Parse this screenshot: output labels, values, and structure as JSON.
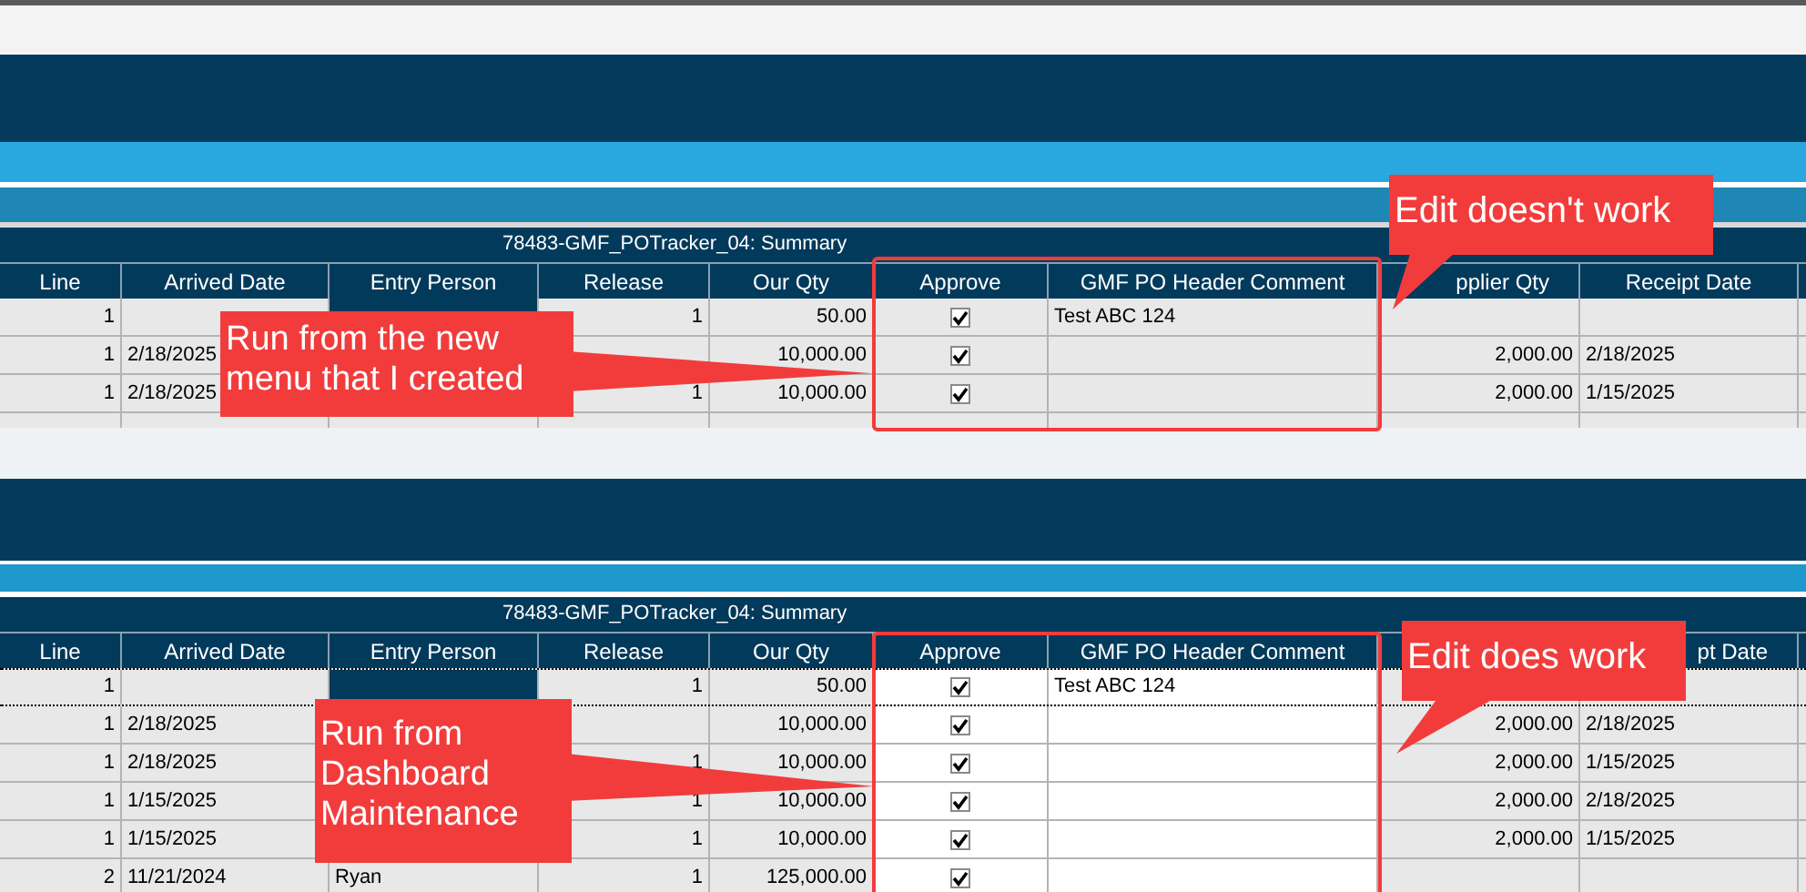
{
  "panels": [
    {
      "title": "78483-GMF_POTracker_04: Summary",
      "editable": false,
      "columns": [
        {
          "label": "Line"
        },
        {
          "label": "Arrived Date"
        },
        {
          "label": "Entry Person"
        },
        {
          "label": "Release"
        },
        {
          "label": "Our Qty"
        },
        {
          "label": "Approve"
        },
        {
          "label": "GMF PO Header Comment"
        },
        {
          "label": "pplier Qty",
          "cut": true
        },
        {
          "label": "Receipt Date"
        }
      ],
      "rows": [
        {
          "line": "1",
          "release": "1",
          "our_qty": "50.00",
          "approved": true,
          "comment": "Test ABC 124",
          "focused": true
        },
        {
          "line": "1",
          "arrived_date": "2/18/2025",
          "our_qty": "10,000.00",
          "approved": true,
          "supplier_qty": "2,000.00",
          "receipt_date": "2/18/2025"
        },
        {
          "line": "1",
          "arrived_date": "2/18/2025",
          "release": "1",
          "our_qty": "10,000.00",
          "approved": true,
          "supplier_qty": "2,000.00",
          "receipt_date": "1/15/2025"
        }
      ],
      "callouts": [
        "Edit doesn't work",
        "Run from the new menu that I created"
      ]
    },
    {
      "title": "78483-GMF_POTracker_04: Summary",
      "editable": true,
      "columns": [
        {
          "label": "Line"
        },
        {
          "label": "Arrived Date"
        },
        {
          "label": "Entry Person"
        },
        {
          "label": "Release"
        },
        {
          "label": "Our Qty"
        },
        {
          "label": "Approve"
        },
        {
          "label": "GMF PO Header Comment"
        },
        {},
        {
          "label": "pt Date",
          "cut": true
        }
      ],
      "rows": [
        {
          "line": "1",
          "release": "1",
          "our_qty": "50.00",
          "approved": true,
          "comment": "Test ABC 124",
          "focused": true,
          "selected": true
        },
        {
          "line": "1",
          "arrived_date": "2/18/2025",
          "our_qty": "10,000.00",
          "approved": true,
          "supplier_qty": "2,000.00",
          "receipt_date": "2/18/2025",
          "selected": false
        },
        {
          "line": "1",
          "arrived_date": "2/18/2025",
          "release": "1",
          "our_qty": "10,000.00",
          "approved": true,
          "supplier_qty": "2,000.00",
          "receipt_date": "1/15/2025",
          "selected": false
        },
        {
          "line": "1",
          "arrived_date": "1/15/2025",
          "release": "1",
          "our_qty": "10,000.00",
          "approved": true,
          "supplier_qty": "2,000.00",
          "receipt_date": "2/18/2025",
          "selected": false
        },
        {
          "line": "1",
          "arrived_date": "1/15/2025",
          "release": "1",
          "our_qty": "10,000.00",
          "approved": true,
          "supplier_qty": "2,000.00",
          "receipt_date": "1/15/2025",
          "selected": false
        },
        {
          "line": "2",
          "arrived_date": "11/21/2024",
          "entry_person": "Ryan",
          "release": "1",
          "our_qty": "125,000.00",
          "approved": true,
          "selected": false
        }
      ],
      "callouts": [
        "Edit does work",
        "Run from Dashboard Maintenance"
      ]
    }
  ]
}
